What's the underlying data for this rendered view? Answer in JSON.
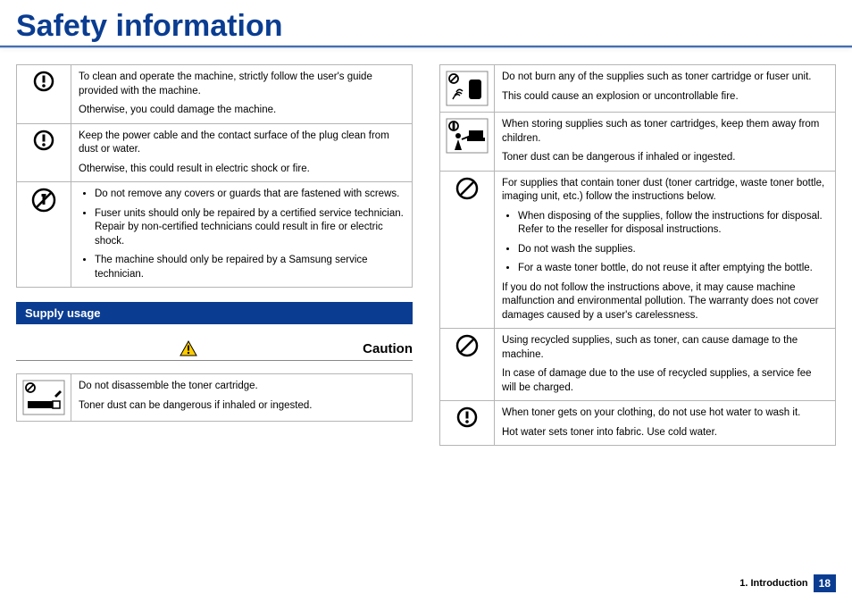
{
  "title": "Safety information",
  "section_bar": "Supply usage",
  "caution": "Caution",
  "left": {
    "r1": {
      "p1": "To clean and operate the machine, strictly follow the user's guide provided with the machine.",
      "p2": "Otherwise, you could damage the machine."
    },
    "r2": {
      "p1": "Keep the power cable and the contact surface of the plug clean from dust or water.",
      "p2": "Otherwise, this could result in electric shock or fire."
    },
    "r3": {
      "b1": "Do not remove any covers or guards that are fastened with screws.",
      "b2": "Fuser units should only be repaired by a certified service technician. Repair by non-certified technicians could result in fire or electric shock.",
      "b3": "The machine should only be repaired by a Samsung service technician."
    },
    "r4": {
      "p1": "Do not disassemble the toner cartridge.",
      "p2": "Toner dust can be dangerous if inhaled or ingested."
    }
  },
  "right": {
    "r1": {
      "p1": "Do not burn any of the supplies such as toner cartridge or fuser unit.",
      "p2": "This could cause an explosion or uncontrollable fire."
    },
    "r2": {
      "p1": "When storing supplies such as toner cartridges, keep them away from children.",
      "p2": "Toner dust can be dangerous if inhaled or ingested."
    },
    "r3": {
      "p1": "For supplies that contain toner dust (toner cartridge, waste toner bottle, imaging unit, etc.) follow the instructions below.",
      "b1": "When disposing of the supplies, follow the instructions for disposal. Refer to the reseller for disposal instructions.",
      "b2": "Do not wash the supplies.",
      "b3": "For a waste toner bottle, do not reuse it after emptying the bottle.",
      "p2": "If you do not follow the instructions above, it may cause machine malfunction and environmental pollution.  The warranty does not cover damages caused by a user's carelessness."
    },
    "r4": {
      "p1": "Using recycled supplies, such as toner, can cause damage to the machine.",
      "p2": "In case of damage due to the use of recycled supplies, a service fee will be charged."
    },
    "r5": {
      "p1": "When toner gets on your clothing, do not use hot water to wash it.",
      "p2": "Hot water sets toner into fabric. Use cold water."
    }
  },
  "footer": {
    "chapter": "1. Introduction",
    "page": "18"
  }
}
